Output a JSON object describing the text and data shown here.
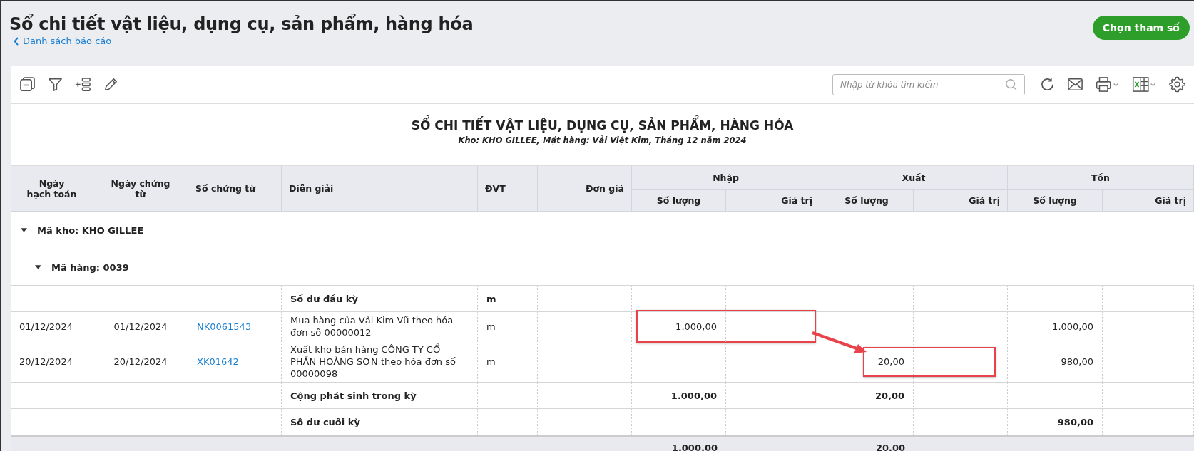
{
  "header": {
    "title": "Sổ chi tiết vật liệu, dụng cụ, sản phẩm, hàng hóa",
    "back_link": "Danh sách báo cáo",
    "action_button": "Chọn tham số"
  },
  "toolbar": {
    "search": {
      "placeholder": "Nhập từ khóa tìm kiếm"
    }
  },
  "report": {
    "title": "SỔ CHI TIẾT VẬT LIỆU, DỤNG CỤ, SẢN PHẨM, HÀNG HÓA",
    "subtitle": "Kho: KHO GILLEE, Mặt hàng: Vải Việt Kim, Tháng 12 năm 2024"
  },
  "table": {
    "columns": [
      "Ngày hạch toán",
      "Ngày chứng từ",
      "Số chứng từ",
      "Diễn giải",
      "ĐVT",
      "Đơn giá"
    ],
    "column_groups": [
      {
        "label": "Nhập",
        "columns": [
          "Số lượng",
          "Giá trị"
        ]
      },
      {
        "label": "Xuất",
        "columns": [
          "Số lượng",
          "Giá trị"
        ]
      },
      {
        "label": "Tồn",
        "columns": [
          "Số lượng",
          "Giá trị"
        ]
      }
    ],
    "groups": [
      {
        "label": "Mã kho: KHO GILLEE",
        "expanded": true,
        "children": [
          {
            "label": "Mã hàng: 0039",
            "expanded": true,
            "rows": [
              {
                "kind": "summary",
                "description": "Số dư đầu kỳ",
                "unit": "m"
              },
              {
                "kind": "entry",
                "posting_date": "01/12/2024",
                "doc_date": "01/12/2024",
                "doc_no": "NK0061543",
                "description": "Mua hàng của Vải Kim Vũ theo hóa đơn số 00000012",
                "unit": "m",
                "import_qty": "1.000,00",
                "stock_qty": "1.000,00",
                "import_highlighted": true
              },
              {
                "kind": "entry",
                "posting_date": "20/12/2024",
                "doc_date": "20/12/2024",
                "doc_no": "XK01642",
                "description": "Xuất kho bán hàng CÔNG TY CỔ PHẦN HOÀNG SƠN theo hóa đơn số 00000098",
                "unit": "m",
                "export_qty": "20,00",
                "stock_qty": "980,00",
                "export_highlighted": true
              },
              {
                "kind": "summary",
                "description": "Cộng phát sinh trong kỳ",
                "import_qty": "1.000,00",
                "export_qty": "20,00"
              },
              {
                "kind": "summary",
                "description": "Số dư cuối kỳ",
                "stock_qty": "980,00"
              }
            ]
          }
        ]
      }
    ],
    "footer": {
      "import_qty": "1.000,00",
      "export_qty": "20,00"
    },
    "annotation_arrow": true
  }
}
